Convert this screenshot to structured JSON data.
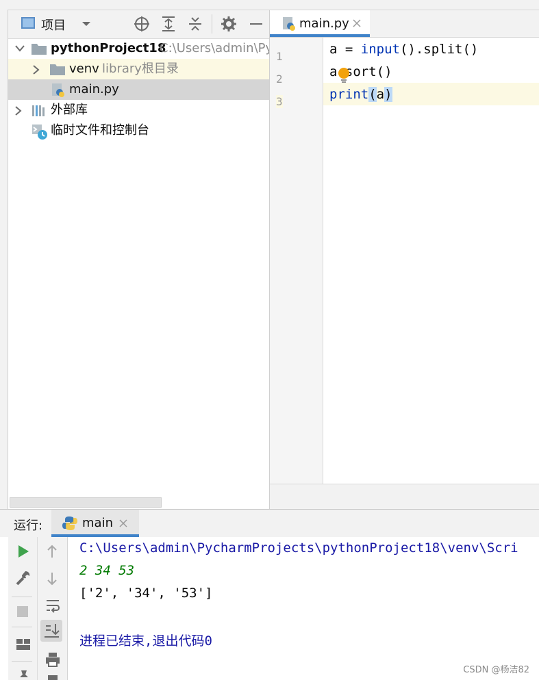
{
  "project_panel": {
    "title": "项目",
    "tree": [
      {
        "label": "pythonProject18",
        "hint": "C:\\Users\\admin\\Py",
        "icon": "folder-icon"
      },
      {
        "label": "venv",
        "hint": "library根目录",
        "icon": "folder-icon"
      },
      {
        "label": "main.py",
        "icon": "python-file-icon"
      },
      {
        "label": "外部库",
        "icon": "library-icon"
      },
      {
        "label": "临时文件和控制台",
        "icon": "scratch-icon"
      }
    ]
  },
  "editor": {
    "tab_label": "main.py",
    "line_numbers": [
      "1",
      "2",
      "3"
    ],
    "line1": {
      "var": "a = ",
      "fn": "input",
      "rest": "().split()"
    },
    "line2": {
      "var": "a",
      "dot": ".",
      "rest": "sort()"
    },
    "line3": {
      "fn": "print",
      "open": "(",
      "arg": "a",
      "close": ")"
    }
  },
  "run": {
    "label": "运行:",
    "tab_label": "main",
    "console": [
      {
        "text": "C:\\Users\\admin\\PycharmProjects\\pythonProject18\\venv\\Scri",
        "color": "#1a1aa6"
      },
      {
        "text": "2 34 53",
        "color": "#007a00"
      },
      {
        "text": "['2', '34', '53']",
        "color": "#080808"
      },
      {
        "text": "进程已结束,退出代码0",
        "color": "#1a1aa6"
      }
    ]
  },
  "watermark": "CSDN @杨洁82"
}
